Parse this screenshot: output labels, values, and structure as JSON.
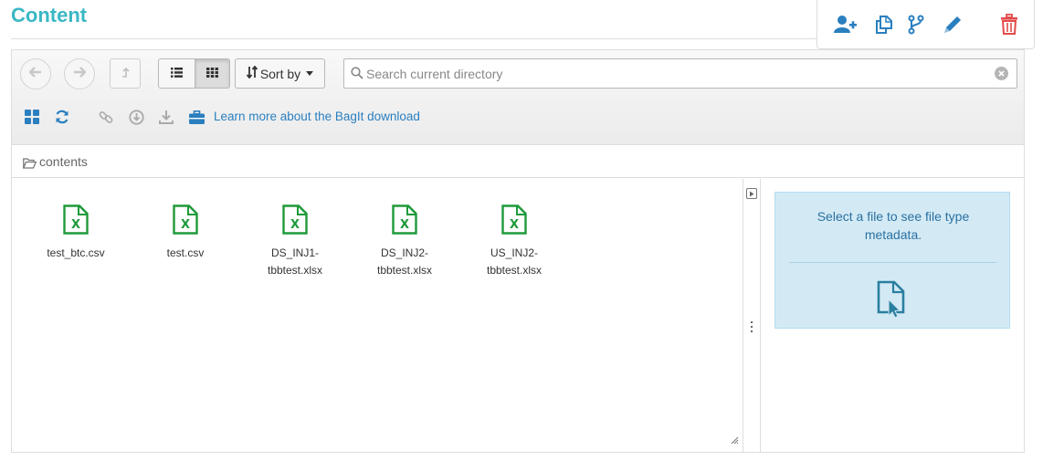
{
  "title": "Content",
  "colors": {
    "title": "#3ab7c4",
    "link": "#2a7fbf",
    "excel": "#1e9a3a",
    "delete": "#e34a4a",
    "action": "#2a7fbf",
    "info_bg": "#d3eaf5",
    "info_text": "#2a70a0"
  },
  "action_bar": [
    {
      "icon": "add-user-icon"
    },
    {
      "icon": "copy-icon"
    },
    {
      "icon": "fork-icon"
    },
    {
      "icon": "pencil-icon"
    },
    {
      "icon": "trash-icon"
    }
  ],
  "toolbar": {
    "back_icon": "arrow-left-icon",
    "forward_icon": "arrow-right-icon",
    "up_icon": "level-up-icon",
    "list_view_icon": "list-icon",
    "grid_view_icon": "grid-icon",
    "sort_label": "Sort by",
    "sort_icon": "sort-icon",
    "search": {
      "placeholder": "Search current directory",
      "value": ""
    },
    "row2_icons": [
      "dashboard-icon",
      "refresh-icon",
      "link-icon",
      "download-circle-icon",
      "download-icon",
      "briefcase-icon"
    ],
    "bagit_link": "Learn more about the BagIt download"
  },
  "breadcrumb": {
    "icon": "folder-open-icon",
    "label": "contents"
  },
  "files": [
    {
      "name_line1": "test_btc.csv",
      "name_line2": "",
      "icon": "excel-file-icon"
    },
    {
      "name_line1": "test.csv",
      "name_line2": "",
      "icon": "excel-file-icon"
    },
    {
      "name_line1": "DS_INJ1-",
      "name_line2": "tbbtest.xlsx",
      "icon": "excel-file-icon"
    },
    {
      "name_line1": "DS_INJ2-",
      "name_line2": "tbbtest.xlsx",
      "icon": "excel-file-icon"
    },
    {
      "name_line1": "US_INJ2-",
      "name_line2": "tbbtest.xlsx",
      "icon": "excel-file-icon"
    }
  ],
  "metadata_panel": {
    "message": "Select a file to see file type metadata.",
    "icon": "file-pointer-icon"
  }
}
